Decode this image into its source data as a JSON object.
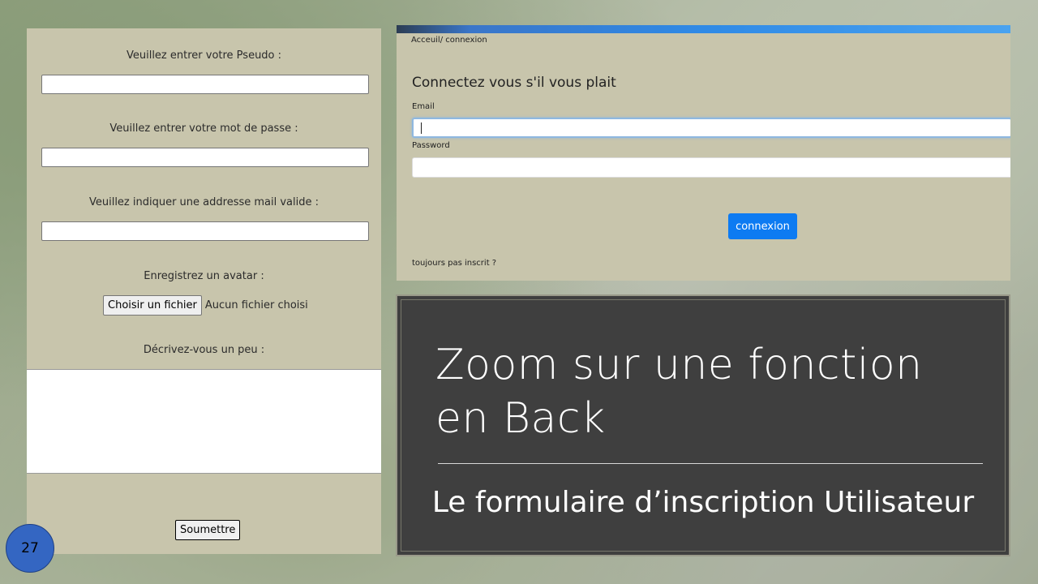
{
  "registration_form": {
    "pseudo_label": "Veuillez entrer votre Pseudo :",
    "password_label": "Veuillez entrer votre mot de passe :",
    "email_label": "Veuillez indiquer une addresse mail valide :",
    "avatar_label": "Enregistrez un avatar :",
    "file_button_label": "Choisir un fichier",
    "file_status": "Aucun fichier choisi",
    "describe_label": "Décrivez-vous un peu :",
    "submit_label": "Soumettre"
  },
  "login_form": {
    "breadcrumb": "Acceuil/ connexion",
    "title": "Connectez vous s'il vous plait",
    "email_label": "Email",
    "password_label": "Password",
    "button_label": "connexion",
    "signup_link": "toujours pas inscrit ?"
  },
  "slide": {
    "title_line1": "Zoom sur une fonction",
    "title_line2": "en Back",
    "subtitle": "Le formulaire d’inscription Utilisateur",
    "page_number": "27"
  },
  "colors": {
    "panel_background": "#c8c5ac",
    "title_box_background": "#3f3f3f",
    "connexion_button": "#0d7bf2",
    "page_badge": "#3466c2"
  }
}
